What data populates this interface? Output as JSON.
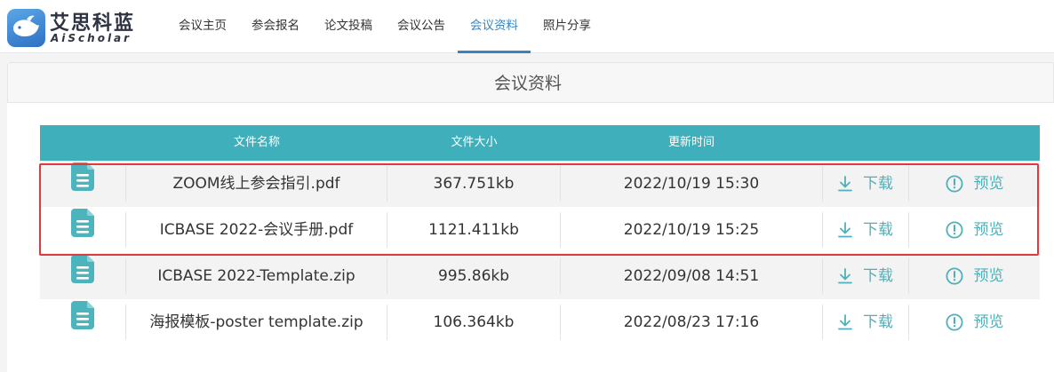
{
  "brand": {
    "name_cn": "艾思科蓝",
    "name_en": "AiScholar",
    "colors": {
      "primary": "#3a84be",
      "table_header": "#3fb0bb",
      "action": "#4fb0b9",
      "highlight": "#e0393e"
    }
  },
  "nav": {
    "items": [
      {
        "label": "会议主页",
        "active": false
      },
      {
        "label": "参会报名",
        "active": false
      },
      {
        "label": "论文投稿",
        "active": false
      },
      {
        "label": "会议公告",
        "active": false
      },
      {
        "label": "会议资料",
        "active": true
      },
      {
        "label": "照片分享",
        "active": false
      }
    ]
  },
  "panel": {
    "title": "会议资料"
  },
  "table": {
    "headers": {
      "name": "文件名称",
      "size": "文件大小",
      "time": "更新时间"
    },
    "download_label": "下载",
    "preview_label": "预览",
    "icons": {
      "file": "file-document-icon",
      "download": "download-icon",
      "preview": "info-circle-icon"
    },
    "rows": [
      {
        "name": "ZOOM线上参会指引.pdf",
        "size": "367.751kb",
        "time": "2022/10/19 15:30",
        "highlighted": true
      },
      {
        "name": "ICBASE 2022-会议手册.pdf",
        "size": "1121.411kb",
        "time": "2022/10/19 15:25",
        "highlighted": true
      },
      {
        "name": "ICBASE 2022-Template.zip",
        "size": "995.86kb",
        "time": "2022/09/08 14:51",
        "highlighted": false
      },
      {
        "name": "海报模板-poster template.zip",
        "size": "106.364kb",
        "time": "2022/08/23 17:16",
        "highlighted": false
      }
    ]
  }
}
